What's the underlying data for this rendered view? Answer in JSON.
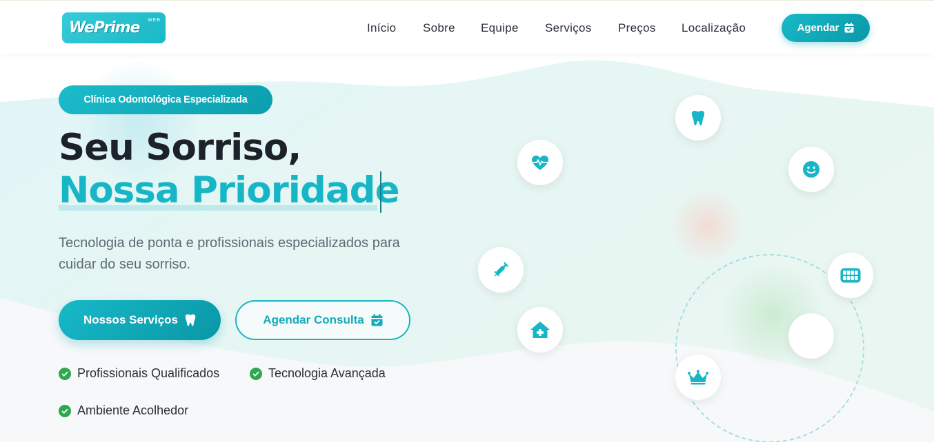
{
  "header": {
    "logo_text": "WePrime",
    "logo_small": "WEB",
    "nav": [
      {
        "label": "Início"
      },
      {
        "label": "Sobre"
      },
      {
        "label": "Equipe"
      },
      {
        "label": "Serviços"
      },
      {
        "label": "Preços"
      },
      {
        "label": "Localização"
      }
    ],
    "cta_label": "Agendar"
  },
  "hero": {
    "badge": "Clínica Odontológica Especializada",
    "title_line1": "Seu Sorriso,",
    "title_line2": "Nossa Prioridade",
    "subtitle_line1": "Tecnologia de ponta e profissionais especializados para",
    "subtitle_line2": "cuidar do seu sorriso.",
    "primary_button": "Nossos Serviços",
    "secondary_button": "Agendar Consulta",
    "features": [
      {
        "label": "Profissionais Qualificados"
      },
      {
        "label": "Tecnologia Avançada"
      },
      {
        "label": "Ambiente Acolhedor"
      }
    ]
  },
  "floating_icons": [
    "tooth-icon",
    "heart-pulse-icon",
    "smile-icon",
    "syringe-icon",
    "teeth-icon",
    "clinic-icon",
    "crown-icon"
  ],
  "colors": {
    "accent": "#17b6c6",
    "accent_dark": "#0a99a9",
    "title": "#1d2129",
    "text": "#616a74",
    "check": "#2ea84e"
  }
}
